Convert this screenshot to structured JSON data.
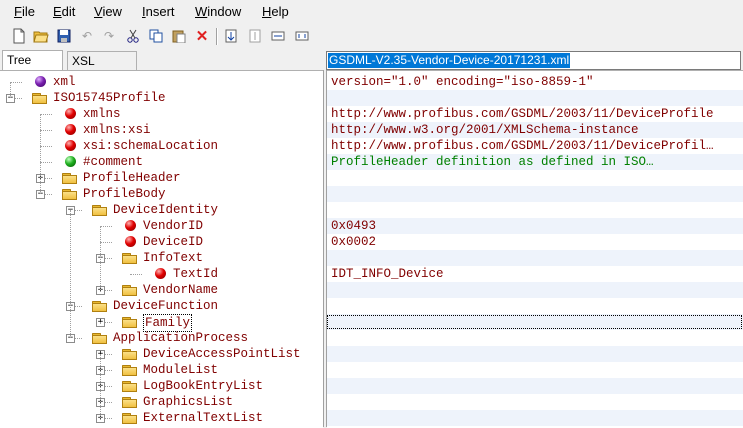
{
  "menu": {
    "items": [
      {
        "label": "File",
        "accel": "F"
      },
      {
        "label": "Edit",
        "accel": "E"
      },
      {
        "label": "View",
        "accel": "V"
      },
      {
        "label": "Insert",
        "accel": "I"
      },
      {
        "label": "Window",
        "accel": "W"
      },
      {
        "label": "Help",
        "accel": "H"
      }
    ]
  },
  "toolbar": {
    "buttons": [
      "new-file-icon",
      "open-folder-icon",
      "save-icon",
      "undo-icon",
      "redo-icon",
      "cut-icon",
      "copy-icon",
      "paste-icon",
      "delete-icon",
      "expand-all-icon",
      "collapse-icon",
      "indent-icon",
      "outdent-icon"
    ],
    "path_value": "GSDML-V2.35-Vendor-Device-20171231.xml"
  },
  "tabs": [
    {
      "label": "Tree View",
      "active": true
    },
    {
      "label": "XSL Output",
      "active": false
    }
  ],
  "tree": [
    {
      "label": "xml",
      "type": "purple",
      "depth": 1,
      "expander": "",
      "value": "version=\"1.0\" encoding=\"iso-8859-1\"",
      "vclass": "blue"
    },
    {
      "label": "ISO15745Profile",
      "type": "folder",
      "depth": 1,
      "expander": "-",
      "value": "",
      "vclass": "blue"
    },
    {
      "label": "xmlns",
      "type": "red",
      "depth": 2,
      "expander": "",
      "value": "http://www.profibus.com/GSDML/2003/11/DeviceProfile",
      "vclass": "blue"
    },
    {
      "label": "xmlns:xsi",
      "type": "red",
      "depth": 2,
      "expander": "",
      "value": "http://www.w3.org/2001/XMLSchema-instance",
      "vclass": "blue"
    },
    {
      "label": "xsi:schemaLocation",
      "type": "red",
      "depth": 2,
      "expander": "",
      "value": "http://www.profibus.com/GSDML/2003/11/DeviceProfil…",
      "vclass": "blue"
    },
    {
      "label": "#comment",
      "type": "green",
      "depth": 2,
      "expander": "",
      "value": "ProfileHeader definition as defined in ISO…",
      "vclass": "green"
    },
    {
      "label": "ProfileHeader",
      "type": "folder",
      "depth": 2,
      "expander": "+",
      "value": "",
      "vclass": "blue"
    },
    {
      "label": "ProfileBody",
      "type": "folder",
      "depth": 2,
      "expander": "-",
      "value": "",
      "vclass": "blue"
    },
    {
      "label": "DeviceIdentity",
      "type": "folder",
      "depth": 3,
      "expander": "-",
      "value": "",
      "vclass": "blue"
    },
    {
      "label": "VendorID",
      "type": "red",
      "depth": 4,
      "expander": "",
      "value": "0x0493",
      "vclass": "blue"
    },
    {
      "label": "DeviceID",
      "type": "red",
      "depth": 4,
      "expander": "",
      "value": "0x0002",
      "vclass": "blue"
    },
    {
      "label": "InfoText",
      "type": "folder",
      "depth": 4,
      "expander": "-",
      "value": "",
      "vclass": "blue"
    },
    {
      "label": "TextId",
      "type": "red",
      "depth": 5,
      "expander": "",
      "value": "IDT_INFO_Device",
      "vclass": "blue"
    },
    {
      "label": "VendorName",
      "type": "folder",
      "depth": 4,
      "expander": "+",
      "value": "",
      "vclass": "blue"
    },
    {
      "label": "DeviceFunction",
      "type": "folder",
      "depth": 3,
      "expander": "-",
      "value": "",
      "vclass": "blue"
    },
    {
      "label": "Family",
      "type": "folder",
      "depth": 4,
      "expander": "+",
      "value": "",
      "vclass": "blue",
      "selected": true
    },
    {
      "label": "ApplicationProcess",
      "type": "folder",
      "depth": 3,
      "expander": "-",
      "value": "",
      "vclass": "blue"
    },
    {
      "label": "DeviceAccessPointList",
      "type": "folder",
      "depth": 4,
      "expander": "+",
      "value": "",
      "vclass": "blue"
    },
    {
      "label": "ModuleList",
      "type": "folder",
      "depth": 4,
      "expander": "+",
      "value": "",
      "vclass": "blue"
    },
    {
      "label": "LogBookEntryList",
      "type": "folder",
      "depth": 4,
      "expander": "+",
      "value": "",
      "vclass": "blue"
    },
    {
      "label": "GraphicsList",
      "type": "folder",
      "depth": 4,
      "expander": "+",
      "value": "",
      "vclass": "blue"
    },
    {
      "label": "ExternalTextList",
      "type": "folder",
      "depth": 4,
      "expander": "+",
      "value": "",
      "vclass": "blue"
    }
  ]
}
